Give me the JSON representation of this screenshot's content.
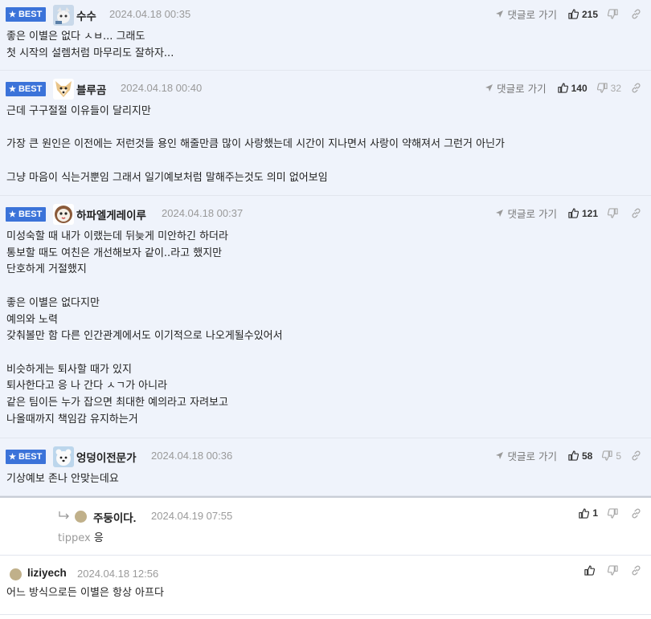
{
  "ui": {
    "best_label": "BEST",
    "reply_label": "댓글로 가기"
  },
  "comments": [
    {
      "nick": "수수",
      "date": "2024.04.18 00:35",
      "up": "215",
      "down": "",
      "lines": [
        "좋은 이별은 없다 ㅅㅂ... 그래도",
        "첫 시작의 설렘처럼 마무리도 잘하자..."
      ]
    },
    {
      "nick": "블루곰",
      "date": "2024.04.18 00:40",
      "up": "140",
      "down": "32",
      "lines": [
        "근데 구구절절 이유들이 달리지만",
        "",
        "가장 큰 원인은 이전에는 저런것들 용인 해줄만큼 많이 사랑했는데 시간이 지나면서 사랑이 약해져서 그런거 아닌가",
        "",
        "그냥 마음이 식는거뿐임 그래서 일기예보처럼 말해주는것도 의미 없어보임"
      ]
    },
    {
      "nick": "하파엘게레이루",
      "date": "2024.04.18 00:37",
      "up": "121",
      "down": "",
      "lines": [
        "미성숙할 때 내가 이랬는데 뒤늦게 미안하긴 하더라",
        "통보할 때도 여친은 개선해보자 같이..라고 했지만",
        "단호하게 거절했지",
        "",
        "좋은 이별은 없다지만",
        "예의와 노력",
        "갖춰볼만 함 다른 인간관계에서도 이기적으로 나오게될수있어서",
        "",
        "비슷하게는 퇴사할 때가 있지",
        "퇴사한다고 응 나 간다 ㅅㄱ가 아니라",
        "같은 팀이든 누가 잡으면 최대한 예의라고 자려보고",
        "나올때까지 책임감 유지하는거"
      ]
    },
    {
      "nick": "엉덩이전문가",
      "date": "2024.04.18 00:36",
      "up": "58",
      "down": "5",
      "lines": [
        "기상예보 존나 안맞는데요"
      ]
    }
  ],
  "reply": {
    "nick": "주둥이다.",
    "date": "2024.04.19 07:55",
    "up": "1",
    "tip": "tippex",
    "text": "응"
  },
  "normal": {
    "nick": "liziyech",
    "date": "2024.04.18 12:56",
    "text": "어느 방식으로든 이별은 항상 아프다"
  },
  "colors": {
    "best_bg": "#eff3fb",
    "badge": "#3b73d9"
  }
}
